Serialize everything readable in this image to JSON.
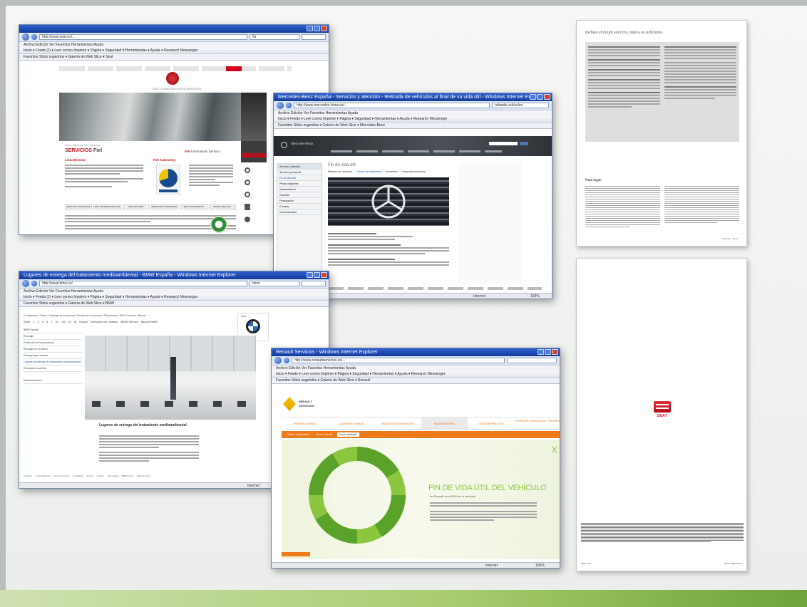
{
  "composition": {
    "accent_green": "#8bbf55",
    "background": "#eceeec"
  },
  "seat_window": {
    "title": "",
    "address": "http://www.seat.es/...",
    "search_text": "fia",
    "menu": "Archivo  Edición  Ver  Favoritos  Herramientas  Ayuda",
    "toolbar": "Inicio  ▾  Feeds (J)  ▾  Leer correo  Imprimir  ▾  Página ▾  Seguridad ▾  Herramientas ▾  Ayuda ▾  Research  Messenger",
    "favorites": "Favoritos   Sitios sugeridos ▾   Galería de Web Slice ▾   Seat",
    "slogan": "SEAT. LA EMOCIÓN VIVE EN NOSOTROS",
    "breadcrumb": "Inicio › Servicios Fiel › Servicios",
    "heading_pre": "SERVICIOS",
    "heading_brand": "Fiel",
    "heading_right_brand": "Fiel",
    "heading_right_text": "Información Servicio",
    "col1_title": "Línea Directa",
    "col2_title": "Fiel Autonomy",
    "tabs": [
      "SERVICIO POSTVENTA",
      "MÁS INFORMACIÓN FIEL",
      "SEGURO SEAT",
      "SERVICIOS FINANCIEROS",
      "SEAT ACCESORIOS",
      "FIN DE VIDA ÚTIL"
    ]
  },
  "mercedes_window": {
    "title": "Mercedes-Benz España - Servicios y atención - Retirada de vehículos al final de su vida útil - Windows Internet Explorer",
    "address": "http://www.mercedes-benz.es/...",
    "search_text": "retirada vehículos",
    "menu": "Archivo  Edición  Ver  Favoritos  Herramientas  Ayuda",
    "toolbar": "Inicio  ▾  Feeds  ▾  Leer correo  Imprimir  ▾  Página ▾  Seguridad ▾  Herramientas ▾  Ayuda ▾  Research  Messenger",
    "favorites": "Favoritos   Sitios sugeridos ▾   Galería de Web Slice ▾   Mercedes-Benz",
    "brand": "Mercedes-Benz",
    "page_heading": "Fin de vida útil",
    "sub_tabs": [
      "Retirada de vehículos",
      "Centros de tratamiento",
      "Normativa",
      "Preguntas frecuentes"
    ],
    "sidebar_items": [
      "Servicio y atención",
      "Servicios postventa",
      "Fin de vida útil",
      "Piezas originales",
      "Mantenimiento",
      "Garantía",
      "Financiación",
      "Contacto",
      "Concesionarios"
    ],
    "status": "Internet",
    "zoom": "100%"
  },
  "bmw_window": {
    "title": "Lugares de entrega del tratamiento medioambiental - BMW España - Windows Internet Explorer",
    "address": "http://www.bmw.es/...",
    "search_text": "bmw",
    "menu": "Archivo  Edición  Ver  Favoritos  Herramientas  Ayuda",
    "toolbar": "Inicio  ▾  Feeds (J)  ▾  Leer correo  Imprimir  ▾  Página ▾  Seguridad ▾  Herramientas ▾  Ayuda ▾  Research  Messenger",
    "favorites": "Favoritos   Sitios sugeridos ▾   Galería de Web Slice ▾   BMW",
    "topnav": "Configurador | Gama | Catálogo de accesorios | Prueba de conducción | Financiación | BMW Services | Buscar",
    "series_nav": [
      "Serie",
      "1",
      "3",
      "5",
      "6",
      "7",
      "X3",
      "X5",
      "Z4",
      "M",
      "Hybrid",
      "Vehículos de Ocasión",
      "BMW Service",
      "Mundo BMW"
    ],
    "sidebar_items": [
      "BMW Service",
      "Reciclaje",
      "Protección de la producción",
      "Reciclaje en el diseño",
      "Entregas para reciclar",
      "Lugares de entrega del tratamiento medioambiental",
      "Eliminación correcta",
      "Más información"
    ],
    "article_heading": "Lugares de entrega del tratamiento medioambiental",
    "footer_links": [
      "Contacto",
      "Concesionarios",
      "Puntos de venta",
      "Actualidad",
      "Prensa",
      "Empleo",
      "Aviso legal",
      "BMW Group",
      "Mapa del sitio"
    ],
    "status": "Internet",
    "logo_text": "BMW"
  },
  "renault_window": {
    "title": "Renault Servicios - Windows Internet Explorer",
    "address": "http://www.renaultservicios.es/...",
    "menu": "Archivo  Edición  Ver  Favoritos  Herramientas  Ayuda",
    "toolbar": "Inicio  ▾  Feeds  ▾  Leer correo  Imprimir  ▾  Página ▾  Seguridad ▾  Herramientas ▾  Ayuda ▾  Research  Messenger",
    "favorites": "Favoritos   Sitios sugeridos ▾   Galería de Web Slice ▾   Renault",
    "brand_top": "RENAULT",
    "brand_bottom": "SERVICIOS",
    "nav": [
      "PROMOCIONES",
      "QUIÉNES SOMOS",
      "NUESTROS SERVICIOS",
      "NUESTRA RED",
      "GUÍA DE PRECIOS",
      "ESPECIAL VEHÍCULOS +30 AÑOS"
    ],
    "sub_nav": [
      "Calidad y Seguridad",
      "Fin de vida útil",
      "Medio ambiente"
    ],
    "headline": "FIN DE VIDA ÚTIL DEL VEHÍCULO",
    "subline": "en Renault es el 95% de tu vehículo",
    "close_mark": "X",
    "status": "Internet",
    "zoom": "100%"
  },
  "seat_doc": {
    "title": "Incluso el mejor servicio, nunca es suficiente.",
    "legal_title": "Nota legal:",
    "footer": "Garantía · SEAT"
  },
  "seat_back": {
    "logo_text": "SEAT",
    "foot_left": "SEAT  |  ES",
    "foot_right": "SEAT SERVICIOS"
  }
}
